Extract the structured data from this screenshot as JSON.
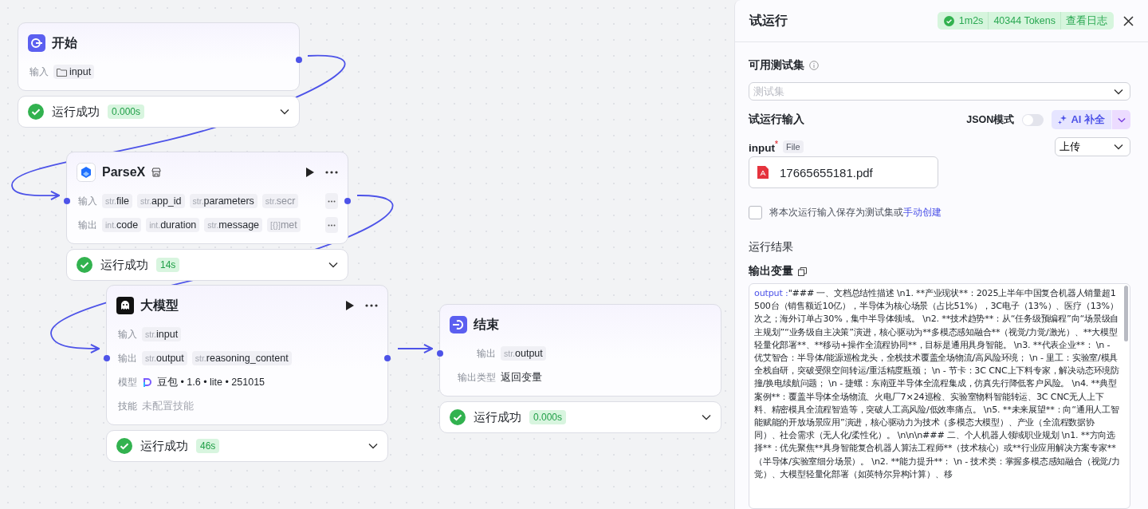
{
  "canvas": {
    "nodes": [
      {
        "kind": "start",
        "title": "开始",
        "runnable": false,
        "rows": [
          {
            "kind": "tags",
            "label": "输入",
            "overflow": false,
            "tags": [
              {
                "kind": "folder",
                "name": "input",
                "faded": false
              }
            ]
          }
        ],
        "status": {
          "kind": "success",
          "text": "运行成功",
          "time": "0.000s"
        }
      },
      {
        "kind": "plugin",
        "title": "ParseX",
        "runnable": true,
        "rows": [
          {
            "kind": "tags",
            "label": "输入",
            "overflow": true,
            "tags": [
              {
                "kind": "typed",
                "prefix": "str.",
                "name": "file",
                "faded": false
              },
              {
                "kind": "typed",
                "prefix": "str.",
                "name": "app_id",
                "faded": false
              },
              {
                "kind": "typed",
                "prefix": "str.",
                "name": "parameters",
                "faded": false
              },
              {
                "kind": "typed",
                "prefix": "str.",
                "name": "secr",
                "faded": true
              }
            ]
          },
          {
            "kind": "tags",
            "label": "输出",
            "overflow": true,
            "tags": [
              {
                "kind": "typed",
                "prefix": "int.",
                "name": "code",
                "faded": false
              },
              {
                "kind": "typed",
                "prefix": "int.",
                "name": "duration",
                "faded": false
              },
              {
                "kind": "typed",
                "prefix": "str.",
                "name": "message",
                "faded": false
              },
              {
                "kind": "typed",
                "prefix": "[{}]",
                "name": "met",
                "faded": true
              }
            ]
          }
        ],
        "status": {
          "kind": "success",
          "text": "运行成功",
          "time": "14s"
        }
      },
      {
        "kind": "llm",
        "title": "大模型",
        "runnable": true,
        "rows": [
          {
            "kind": "tags",
            "label": "输入",
            "overflow": false,
            "tags": [
              {
                "kind": "typed",
                "prefix": "str.",
                "name": "input",
                "faded": false
              }
            ]
          },
          {
            "kind": "tags",
            "label": "输出",
            "overflow": false,
            "tags": [
              {
                "kind": "typed",
                "prefix": "str.",
                "name": "output",
                "faded": false
              },
              {
                "kind": "typed",
                "prefix": "str.",
                "name": "reasoning_content",
                "faded": false
              }
            ]
          },
          {
            "kind": "model",
            "label": "模型",
            "value": "豆包 • 1.6 • lite • 251015"
          },
          {
            "kind": "muted",
            "label": "技能",
            "value": "未配置技能"
          }
        ],
        "status": {
          "kind": "success",
          "text": "运行成功",
          "time": "46s"
        }
      },
      {
        "kind": "end",
        "title": "结束",
        "runnable": false,
        "rows": [
          {
            "kind": "tags",
            "label": "输出",
            "overflow": false,
            "tags": [
              {
                "kind": "typed",
                "prefix": "str.",
                "name": "output",
                "faded": false
              }
            ]
          },
          {
            "kind": "text",
            "label": "输出类型",
            "value": "返回变量"
          }
        ],
        "status": {
          "kind": "success",
          "text": "运行成功",
          "time": "0.000s"
        }
      }
    ]
  },
  "panel": {
    "title": "试运行",
    "summary": {
      "kind": "success",
      "duration": "1m2s",
      "tokens": "40344 Tokens",
      "log_link": "查看日志"
    },
    "test_set": {
      "label": "可用测试集",
      "placeholder": "测试集"
    },
    "run_input": {
      "label": "试运行输入",
      "json_mode": {
        "label": "JSON模式",
        "on": false
      },
      "ai_button": "AI 补全",
      "field": {
        "name": "input",
        "required_mark": "*",
        "type": "File",
        "mode": "上传",
        "file": "17665655181.pdf"
      }
    },
    "save_option": {
      "checked": false,
      "text": "将本次运行输入保存为测试集或",
      "link": "手动创建"
    },
    "result": {
      "label": "运行结果",
      "output_label": "输出变量",
      "key": "output :",
      "value": "\"### 一、文档总结性描述 \\n1. **产业现状**：2025上半年中国复合机器人销量超1500台（销售额近10亿），半导体为核心场景（占比51%），3C电子（13%）、医疗（13%）次之；海外订单占30%，集中半导体领域。 \\n2. **技术趋势**：从“任务级预编程”向“场景级自主规划”“业务级自主决策”演进，核心驱动为**多模态感知融合**（视觉/力觉/激光）、**大模型轻量化部署**、**移动+操作全流程协同**，目标是通用具身智能。 \\n3. **代表企业**： \\n - 优艾智合：半导体/能源巡检龙头，全栈技术覆盖全场物流/高风险环境； \\n - 里工：实验室/模具全栈自研，突破受限空间转运/重活精度瓶颈； \\n - 节卡：3C CNC上下料专家，解决动态环境防撞/换电续航问题； \\n - 捷螺：东南亚半导体全流程集成，仿真先行降低客户风险。 \\n4. **典型案例**：覆盖半导体全场物流、火电厂7×24巡检、实验室物料智能转运、3C CNC无人上下料、精密模具全流程智造等，突破人工高风险/低效率痛点。 \\n5. **未来展望**：向“通用人工智能赋能的开放场景应用”演进，核心驱动力为技术（多模态大模型）、产业（全流程数据协同）、社会需求（无人化/柔性化）。 \\n\\n\\n### 二、个人机器人领域职业规划 \\n1. **方向选择**：优先聚焦**具身智能复合机器人算法工程师**（技术核心）或**行业应用解决方案专家**（半导体/实验室细分场景）。 \\n2. **能力提升**： \\n - 技术类：掌握多模态感知融合（视觉/力觉）、大模型轻量化部署（如英特尔异构计算）、移"
    }
  }
}
